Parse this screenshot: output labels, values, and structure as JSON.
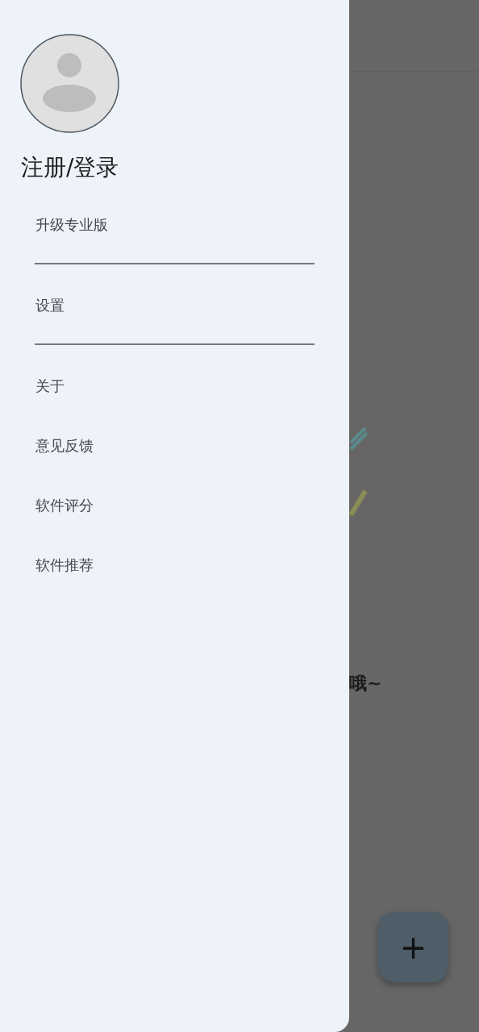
{
  "drawer": {
    "login_label": "注册/登录",
    "items": [
      {
        "label": "升级专业版",
        "divider": true
      },
      {
        "label": "设置",
        "divider": true
      },
      {
        "label": "关于",
        "divider": false
      },
      {
        "label": "意见反馈",
        "divider": false
      },
      {
        "label": "软件评分",
        "divider": false
      },
      {
        "label": "软件推荐",
        "divider": false
      }
    ]
  },
  "background": {
    "hint_text": "哦~",
    "fab": "+"
  }
}
